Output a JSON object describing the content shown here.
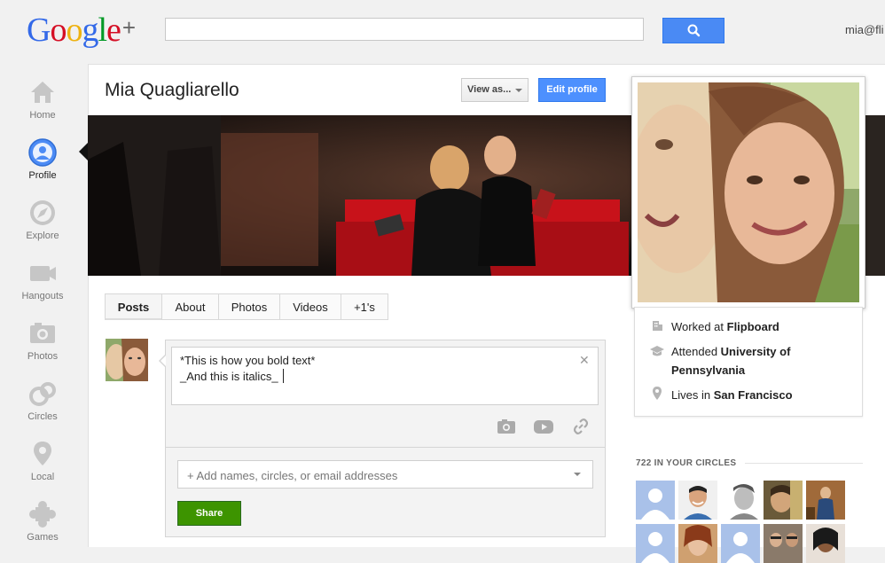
{
  "header": {
    "logo": {
      "g1": "G",
      "o1": "o",
      "o2": "o",
      "g2": "g",
      "l": "l",
      "e": "e",
      "plus": "+"
    },
    "search_placeholder": "",
    "user_email": "mia@fli"
  },
  "sidebar": {
    "items": [
      {
        "label": "Home",
        "icon": "home-icon"
      },
      {
        "label": "Profile",
        "icon": "profile-icon"
      },
      {
        "label": "Explore",
        "icon": "compass-icon"
      },
      {
        "label": "Hangouts",
        "icon": "camera-icon"
      },
      {
        "label": "Photos",
        "icon": "photo-icon"
      },
      {
        "label": "Circles",
        "icon": "circles-icon"
      },
      {
        "label": "Local",
        "icon": "pin-icon"
      },
      {
        "label": "Games",
        "icon": "puzzle-icon"
      }
    ]
  },
  "profile": {
    "name": "Mia Quagliarello",
    "view_as_label": "View as...",
    "edit_label": "Edit profile"
  },
  "tabs": [
    "Posts",
    "About",
    "Photos",
    "Videos",
    "+1's"
  ],
  "post": {
    "line1": "*This is how you bold text*",
    "line2": "_And this is italics_",
    "recipients_placeholder": "+ Add names, circles, or email addresses",
    "share_label": "Share"
  },
  "info": {
    "worked_prefix": "Worked at ",
    "worked_value": "Flipboard",
    "attended_prefix": "Attended ",
    "attended_value_1": "University of",
    "attended_value_2": "Pennsylvania",
    "lives_prefix": "Lives in ",
    "lives_value": "San Francisco"
  },
  "circles": {
    "title": "722 IN YOUR CIRCLES"
  },
  "colors": {
    "primary_blue": "#4d90fe",
    "share_green": "#3d9400",
    "google_blue": "#3369e8",
    "google_red": "#d50f25",
    "google_yellow": "#eeb211",
    "google_green": "#009925"
  }
}
